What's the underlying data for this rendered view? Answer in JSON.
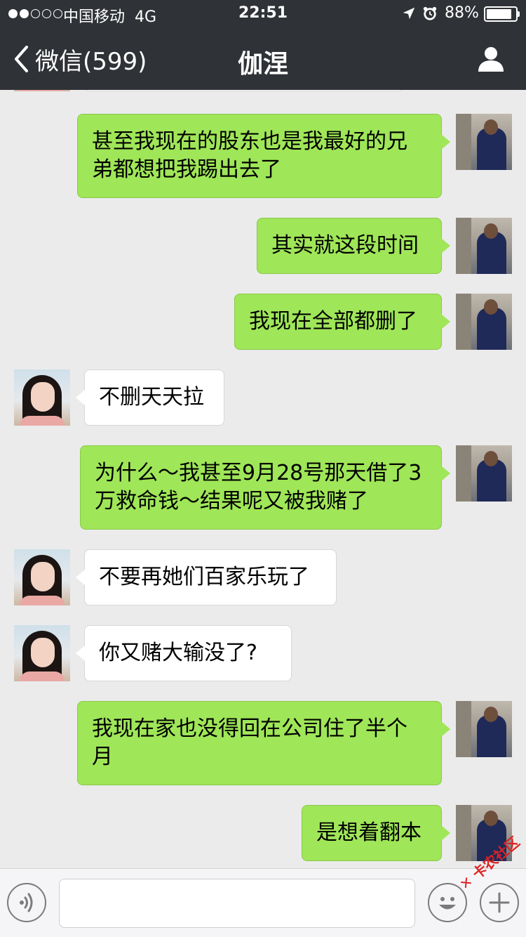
{
  "status_bar": {
    "carrier": "中国移动",
    "network": "4G",
    "time": "22:51",
    "battery_percent": "88%",
    "battery_level": 0.88,
    "signal_bars_filled": 2,
    "signal_bars_total": 5
  },
  "nav": {
    "back_label": "微信(599)",
    "title": "伽涅"
  },
  "messages": [
    {
      "sender": "me",
      "text": "甚至我现在的股东也是我最好的兄弟都想把我踢出去了"
    },
    {
      "sender": "me",
      "text": "其实就这段时间"
    },
    {
      "sender": "me",
      "text": "我现在全部都删了"
    },
    {
      "sender": "her",
      "text": "不删天天拉"
    },
    {
      "sender": "me",
      "text": "为什么～我甚至9月28号那天借了3万救命钱～结果呢又被我赌了"
    },
    {
      "sender": "her",
      "text": "不要再她们百家乐玩了"
    },
    {
      "sender": "her",
      "text": "你又赌大输没了?"
    },
    {
      "sender": "me",
      "text": "我现在家也没得回在公司住了半个月"
    },
    {
      "sender": "me",
      "text": "是想着翻本"
    }
  ],
  "watermark": "卡农社区",
  "colors": {
    "nav_bg": "#2f3236",
    "chat_bg": "#ebebeb",
    "my_bubble": "#9fe658",
    "their_bubble": "#ffffff"
  }
}
